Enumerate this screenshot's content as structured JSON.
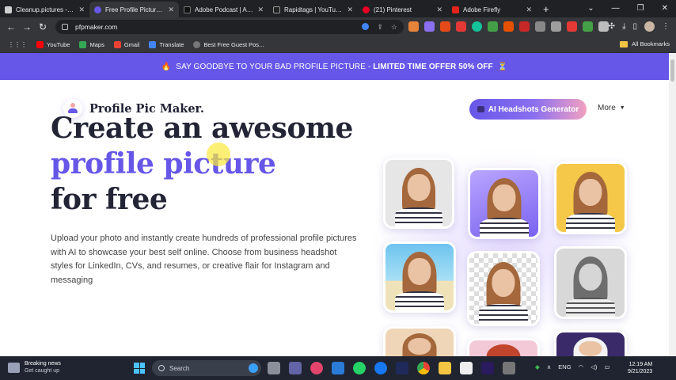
{
  "browser": {
    "tabs": [
      {
        "title": "Cleanup.pictures - Re",
        "color": "#d0d0d0",
        "active": false
      },
      {
        "title": "Free Profile Picture M",
        "color": "#6657e8",
        "active": true
      },
      {
        "title": "Adobe Podcast | AI au",
        "color": "#111111",
        "active": false
      },
      {
        "title": "Rapidtags | YouTube T",
        "color": "#222222",
        "active": false
      },
      {
        "title": "(21) Pinterest",
        "color": "#e60023",
        "active": false
      },
      {
        "title": "Adobe Firefly",
        "color": "#e1251b",
        "active": false
      }
    ],
    "url": "pfpmaker.com",
    "bookmarks": [
      {
        "label": "YouTube",
        "color": "#ff0000"
      },
      {
        "label": "Maps",
        "color": "#34a853"
      },
      {
        "label": "Gmail",
        "color": "#ea4335"
      },
      {
        "label": "Translate",
        "color": "#4285f4"
      },
      {
        "label": "Best Free Guest Pos...",
        "color": "#777777"
      }
    ],
    "all_bookmarks": "All Bookmarks"
  },
  "page": {
    "promo_text": "SAY GOODBYE TO YOUR BAD PROFILE PICTURE - ",
    "promo_offer": "LIMITED TIME OFFER 50% OFF",
    "logo_text": "Profile Pic Maker.",
    "ai_button": "AI Headshots Generator",
    "more_label": "More",
    "headline_line1": "Create an awesome",
    "headline_line2": "profile picture",
    "headline_line3": "for free",
    "description": "Upload your photo and instantly create hundreds of professional profile pictures with AI to showcase your best self online. Choose from business headshot styles for LinkedIn, CVs, and resumes, or creative flair for Instagram and messaging",
    "accent_color": "#6657e8"
  },
  "taskbar": {
    "news_title": "Breaking news",
    "news_sub": "Get caught up",
    "search_placeholder": "Search",
    "lang": "ENG",
    "time": "12:19 AM",
    "date": "9/21/2023"
  }
}
